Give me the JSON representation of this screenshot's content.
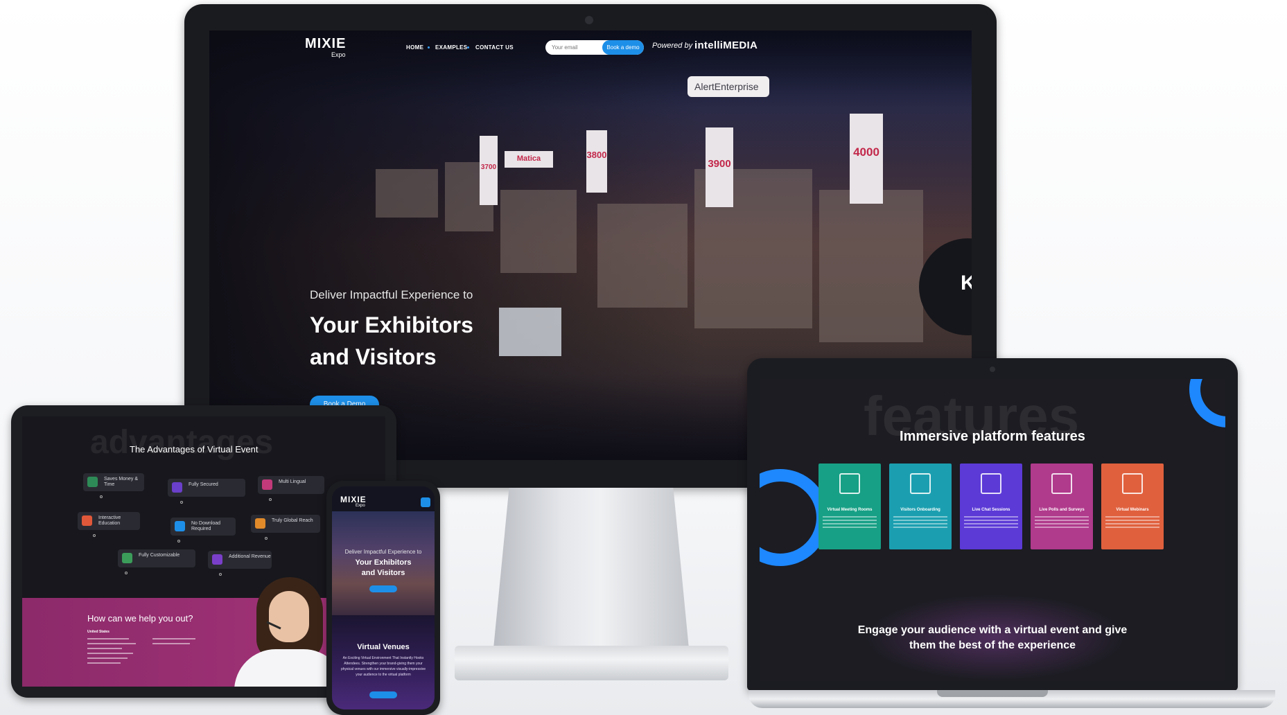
{
  "desktop": {
    "brand": {
      "name": "MIXIE",
      "sub": "Expo"
    },
    "nav": [
      "HOME",
      "EXAMPLES",
      "CONTACT US"
    ],
    "email_placeholder": "Your email",
    "book_demo_pill": "Book a demo",
    "powered_by": "Powered by",
    "partner": "intelliMEDIA",
    "hero": {
      "subtitle": "Deliver Impactful Experience to",
      "title_line1": "Your Exhibitors",
      "title_line2": "and Visitors",
      "button": "Book a Demo"
    },
    "scene_signs": [
      "AlertEnterprise",
      "3800",
      "3900",
      "4000",
      "3700",
      "Matica",
      "KEYTRA"
    ]
  },
  "tablet": {
    "ghost_word": "advantages",
    "heading": "The Advantages of Virtual Event",
    "cards": [
      {
        "label": "Saves Money & Time",
        "color": "#2e8b57"
      },
      {
        "label": "Fully Secured",
        "color": "#6a3fc9"
      },
      {
        "label": "Multi Lingual",
        "color": "#c23a7a"
      },
      {
        "label": "Interactive Education",
        "color": "#e0583a"
      },
      {
        "label": "No Download Required",
        "color": "#1e8fe8"
      },
      {
        "label": "Truly Global Reach",
        "color": "#e08a2a"
      },
      {
        "label": "Fully Customizable",
        "color": "#3b9c5a"
      },
      {
        "label": "Additional Revenue",
        "color": "#7a3fc9"
      }
    ],
    "help_title": "How can we help you out?",
    "help_country": "United States"
  },
  "phone": {
    "brand": {
      "name": "MIXIE",
      "sub": "Expo"
    },
    "hero_sub": "Deliver Impactful Experience to",
    "hero_line1": "Your Exhibitors",
    "hero_line2": "and Visitors",
    "venues_title": "Virtual Venues",
    "venues_text": "An Exciting Virtual Environment That Instantly Hooks Attendees. Strengthen your brand-giving them your physical venues with our immersive visually-impressive your audience to the virtual platform"
  },
  "laptop": {
    "ghost_word": "features",
    "title": "Immersive platform features",
    "cards": [
      {
        "label": "Virtual Meeting Rooms",
        "color": "#17a085"
      },
      {
        "label": "Visitors Onboarding",
        "color": "#1b9fb0"
      },
      {
        "label": "Live Chat Sessions",
        "color": "#5b3ad6"
      },
      {
        "label": "Live Polls and Surveys",
        "color": "#b03a8c"
      },
      {
        "label": "Virtual Webinars",
        "color": "#e0603e"
      }
    ],
    "engage_line1": "Engage your audience with a virtual event and give",
    "engage_line2": "them the best of the experience"
  },
  "colors": {
    "accent": "#1e8fe8",
    "ring": "#1e88ff",
    "pink": "#a53479"
  },
  "icons": [
    "camera-icon",
    "email-icon",
    "menu-icon",
    "meeting-icon",
    "onboarding-icon",
    "chat-icon",
    "poll-icon",
    "webinar-icon"
  ]
}
